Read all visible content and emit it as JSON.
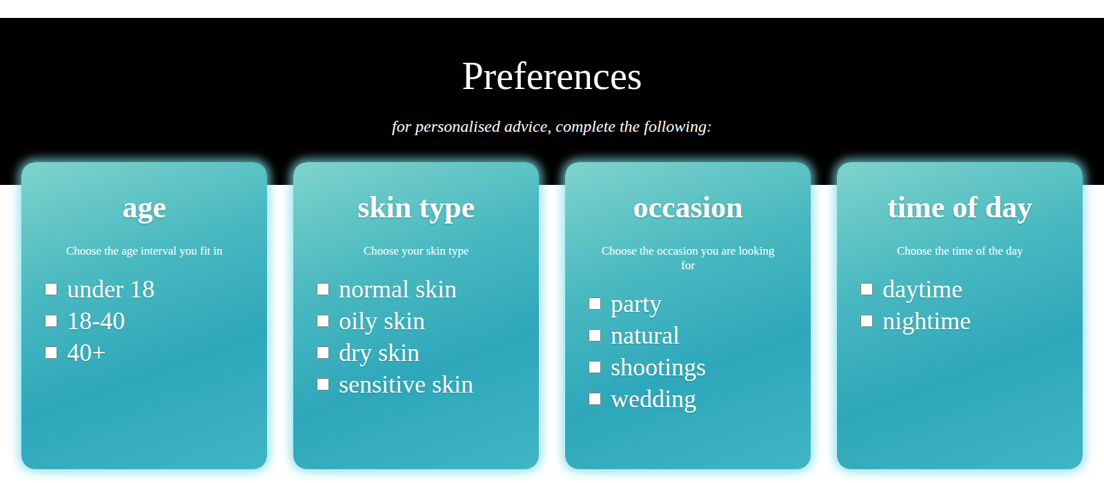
{
  "page": {
    "title": "Preferences",
    "subtitle": "for personalised advice, complete the following:"
  },
  "cards": [
    {
      "title": "age",
      "description": "Choose the age interval you fit in",
      "options": [
        {
          "label": "under 18",
          "checked": false
        },
        {
          "label": "18-40",
          "checked": false
        },
        {
          "label": "40+",
          "checked": false
        }
      ]
    },
    {
      "title": "skin type",
      "description": "Choose your skin type",
      "options": [
        {
          "label": "normal skin",
          "checked": false
        },
        {
          "label": "oily skin",
          "checked": false
        },
        {
          "label": "dry skin",
          "checked": false
        },
        {
          "label": "sensitive skin",
          "checked": false
        }
      ]
    },
    {
      "title": "occasion",
      "description": "Choose the occasion you are looking for",
      "options": [
        {
          "label": "party",
          "checked": false
        },
        {
          "label": "natural",
          "checked": false
        },
        {
          "label": "shootings",
          "checked": false
        },
        {
          "label": "wedding",
          "checked": false
        }
      ]
    },
    {
      "title": "time of day",
      "description": "Choose the time of the day",
      "options": [
        {
          "label": "daytime",
          "checked": false
        },
        {
          "label": "nightime",
          "checked": false
        }
      ]
    }
  ]
}
